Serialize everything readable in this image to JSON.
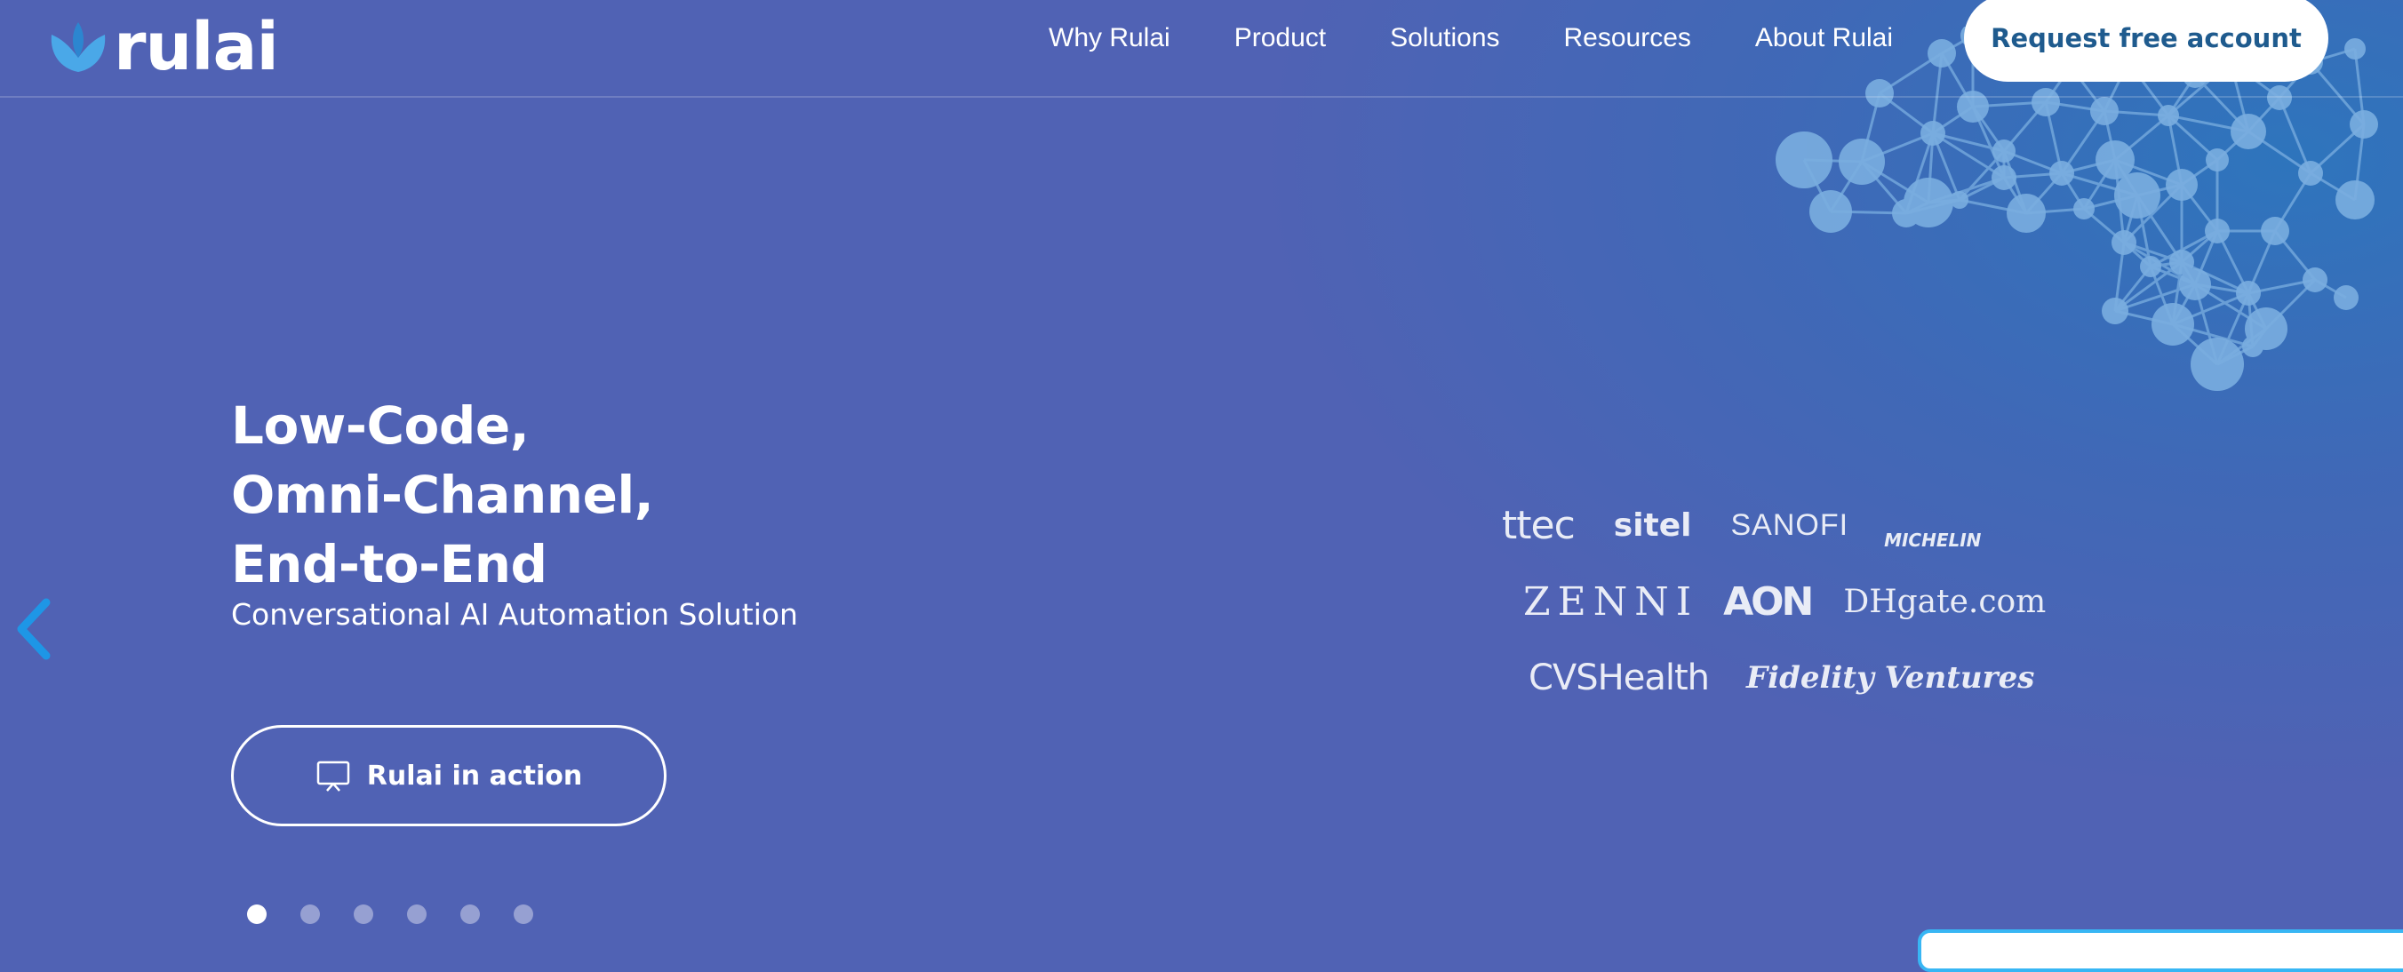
{
  "brand": {
    "logo_text": "rulai",
    "logo_icon": "lotus-icon"
  },
  "nav": {
    "items": [
      {
        "label": "Why Rulai"
      },
      {
        "label": "Product"
      },
      {
        "label": "Solutions"
      },
      {
        "label": "Resources"
      },
      {
        "label": "About Rulai"
      }
    ],
    "cta_label": "Request free account"
  },
  "hero": {
    "title_lines": [
      "Low-Code,",
      "Omni-Channel,",
      "End-to-End"
    ],
    "subtitle": "Conversational AI Automation Solution",
    "action_label": "Rulai in action",
    "action_icon": "presentation-screen-icon"
  },
  "carousel": {
    "slide_count": 6,
    "active_index": 0,
    "prev_icon": "chevron-left-icon"
  },
  "clients": {
    "rows": [
      [
        "ttec",
        "sitel",
        "SANOFI",
        "MICHELIN"
      ],
      [
        "ZENNI",
        "AON",
        "DHgate.com"
      ],
      [
        "CVSHealth",
        "Fidelity Ventures"
      ]
    ]
  },
  "colors": {
    "background": "#5062b4",
    "accent_cta_text": "#1f5b8e",
    "arrow": "#1e96e6",
    "network": "#6da3d8"
  }
}
